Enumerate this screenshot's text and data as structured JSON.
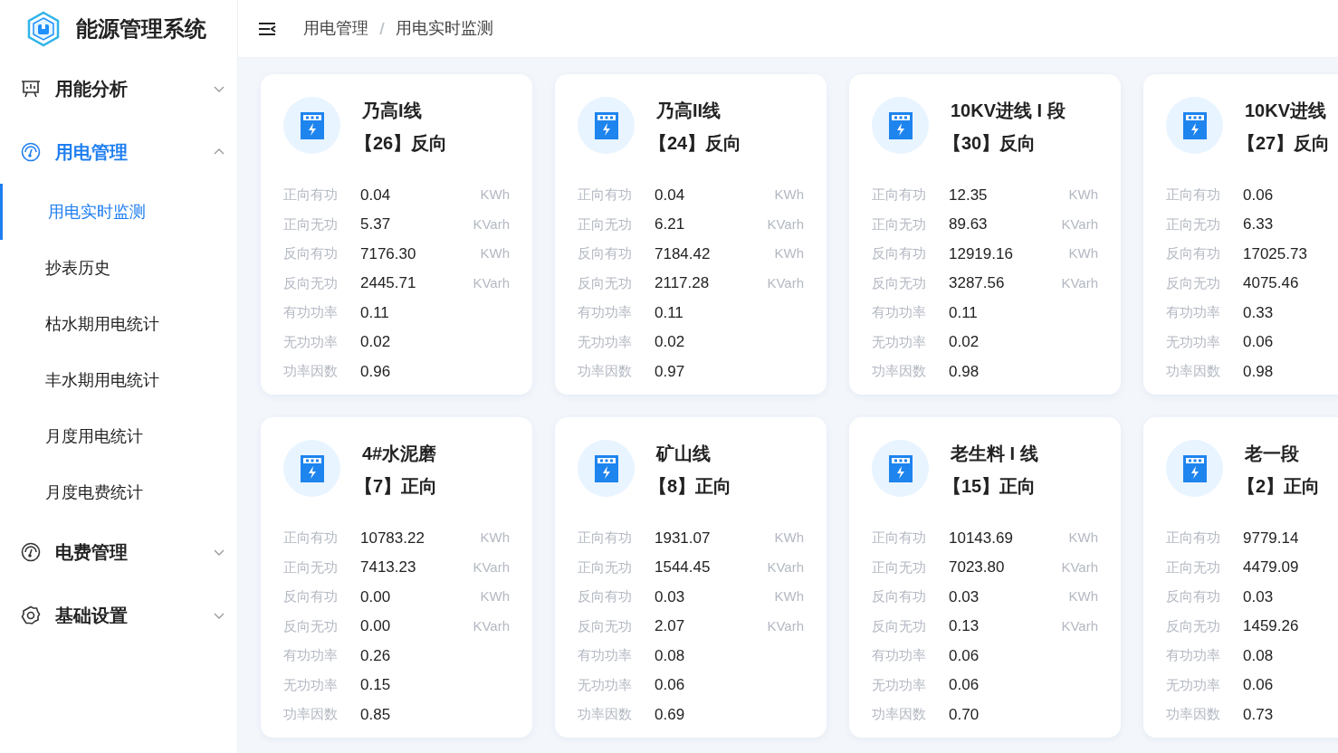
{
  "app": {
    "title": "能源管理系统"
  },
  "sidebar": {
    "items": [
      {
        "label": "用能分析",
        "kind": "board",
        "expanded": false,
        "selected": false
      },
      {
        "label": "用电管理",
        "kind": "gauge",
        "expanded": true,
        "selected": true,
        "children": [
          {
            "label": "用电实时监测",
            "selected": true
          },
          {
            "label": "抄表历史",
            "selected": false
          },
          {
            "label": "枯水期用电统计",
            "selected": false
          },
          {
            "label": "丰水期用电统计",
            "selected": false
          },
          {
            "label": "月度用电统计",
            "selected": false
          },
          {
            "label": "月度电费统计",
            "selected": false
          }
        ]
      },
      {
        "label": "电费管理",
        "kind": "gauge",
        "expanded": false,
        "selected": false
      },
      {
        "label": "基础设置",
        "kind": "gear",
        "expanded": false,
        "selected": false
      }
    ]
  },
  "breadcrumb": [
    "用电管理",
    "用电实时监测"
  ],
  "cards": [
    {
      "title": "乃高I线",
      "subtitle": "【26】反向",
      "rows": [
        {
          "label": "正向有功",
          "value": "0.04",
          "unit": "KWh"
        },
        {
          "label": "正向无功",
          "value": "5.37",
          "unit": "KVarh"
        },
        {
          "label": "反向有功",
          "value": "7176.30",
          "unit": "KWh"
        },
        {
          "label": "反向无功",
          "value": "2445.71",
          "unit": "KVarh"
        },
        {
          "label": "有功功率",
          "value": "0.11"
        },
        {
          "label": "无功功率",
          "value": "0.02"
        },
        {
          "label": "功率因数",
          "value": "0.96"
        }
      ]
    },
    {
      "title": "乃高II线",
      "subtitle": "【24】反向",
      "rows": [
        {
          "label": "正向有功",
          "value": "0.04",
          "unit": "KWh"
        },
        {
          "label": "正向无功",
          "value": "6.21",
          "unit": "KVarh"
        },
        {
          "label": "反向有功",
          "value": "7184.42",
          "unit": "KWh"
        },
        {
          "label": "反向无功",
          "value": "2117.28",
          "unit": "KVarh"
        },
        {
          "label": "有功功率",
          "value": "0.11"
        },
        {
          "label": "无功功率",
          "value": "0.02"
        },
        {
          "label": "功率因数",
          "value": "0.97"
        }
      ]
    },
    {
      "title": "10KV进线 I 段",
      "subtitle": "【30】反向",
      "rows": [
        {
          "label": "正向有功",
          "value": "12.35",
          "unit": "KWh"
        },
        {
          "label": "正向无功",
          "value": "89.63",
          "unit": "KVarh"
        },
        {
          "label": "反向有功",
          "value": "12919.16",
          "unit": "KWh"
        },
        {
          "label": "反向无功",
          "value": "3287.56",
          "unit": "KVarh"
        },
        {
          "label": "有功功率",
          "value": "0.11"
        },
        {
          "label": "无功功率",
          "value": "0.02"
        },
        {
          "label": "功率因数",
          "value": "0.98"
        }
      ]
    },
    {
      "title": "10KV进线",
      "subtitle": "【27】反向",
      "rows": [
        {
          "label": "正向有功",
          "value": "0.06"
        },
        {
          "label": "正向无功",
          "value": "6.33"
        },
        {
          "label": "反向有功",
          "value": "17025.73"
        },
        {
          "label": "反向无功",
          "value": "4075.46"
        },
        {
          "label": "有功功率",
          "value": "0.33"
        },
        {
          "label": "无功功率",
          "value": "0.06"
        },
        {
          "label": "功率因数",
          "value": "0.98"
        }
      ]
    },
    {
      "title": "4#水泥磨",
      "subtitle": "【7】正向",
      "rows": [
        {
          "label": "正向有功",
          "value": "10783.22",
          "unit": "KWh"
        },
        {
          "label": "正向无功",
          "value": "7413.23",
          "unit": "KVarh"
        },
        {
          "label": "反向有功",
          "value": "0.00",
          "unit": "KWh"
        },
        {
          "label": "反向无功",
          "value": "0.00",
          "unit": "KVarh"
        },
        {
          "label": "有功功率",
          "value": "0.26"
        },
        {
          "label": "无功功率",
          "value": "0.15"
        },
        {
          "label": "功率因数",
          "value": "0.85"
        }
      ]
    },
    {
      "title": "矿山线",
      "subtitle": "【8】正向",
      "rows": [
        {
          "label": "正向有功",
          "value": "1931.07",
          "unit": "KWh"
        },
        {
          "label": "正向无功",
          "value": "1544.45",
          "unit": "KVarh"
        },
        {
          "label": "反向有功",
          "value": "0.03",
          "unit": "KWh"
        },
        {
          "label": "反向无功",
          "value": "2.07",
          "unit": "KVarh"
        },
        {
          "label": "有功功率",
          "value": "0.08"
        },
        {
          "label": "无功功率",
          "value": "0.06"
        },
        {
          "label": "功率因数",
          "value": "0.69"
        }
      ]
    },
    {
      "title": "老生料 I 线",
      "subtitle": "【15】正向",
      "rows": [
        {
          "label": "正向有功",
          "value": "10143.69",
          "unit": "KWh"
        },
        {
          "label": "正向无功",
          "value": "7023.80",
          "unit": "KVarh"
        },
        {
          "label": "反向有功",
          "value": "0.03",
          "unit": "KWh"
        },
        {
          "label": "反向无功",
          "value": "0.13",
          "unit": "KVarh"
        },
        {
          "label": "有功功率",
          "value": "0.06"
        },
        {
          "label": "无功功率",
          "value": "0.06"
        },
        {
          "label": "功率因数",
          "value": "0.70"
        }
      ]
    },
    {
      "title": "老一段",
      "subtitle": "【2】正向",
      "rows": [
        {
          "label": "正向有功",
          "value": "9779.14"
        },
        {
          "label": "正向无功",
          "value": "4479.09"
        },
        {
          "label": "反向有功",
          "value": "0.03"
        },
        {
          "label": "反向无功",
          "value": "1459.26"
        },
        {
          "label": "有功功率",
          "value": "0.08"
        },
        {
          "label": "无功功率",
          "value": "0.06"
        },
        {
          "label": "功率因数",
          "value": "0.73"
        }
      ]
    }
  ]
}
